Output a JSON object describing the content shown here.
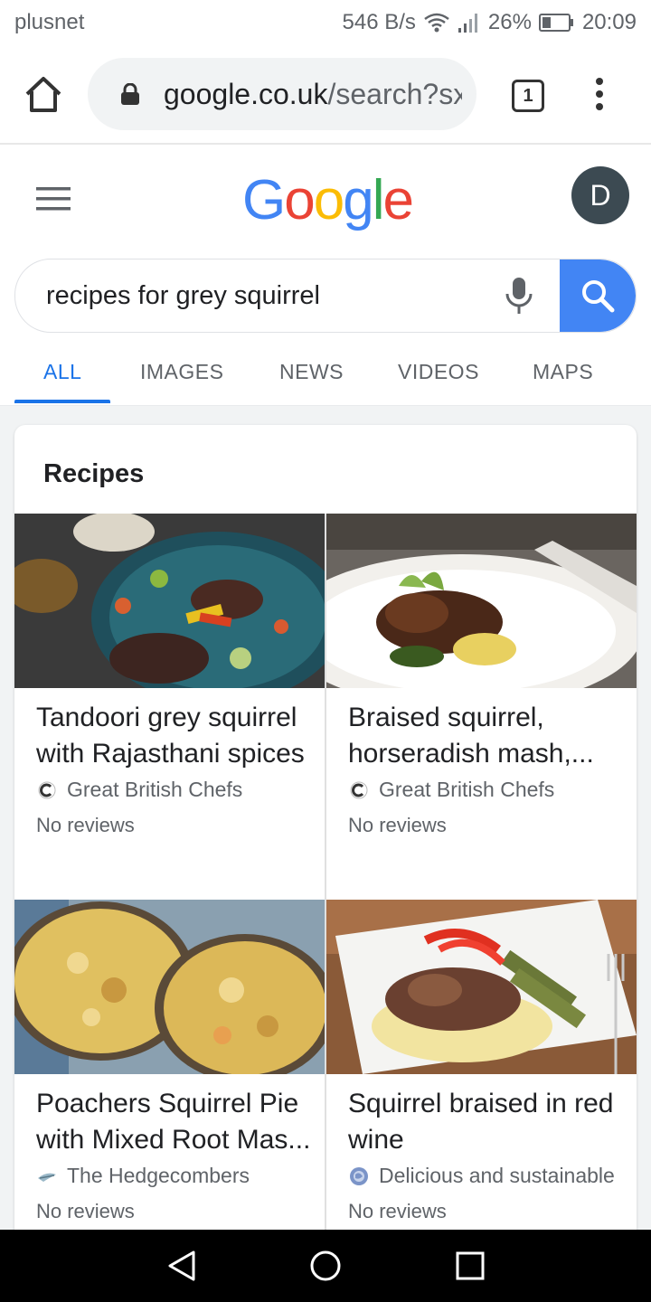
{
  "status_bar": {
    "carrier": "plusnet",
    "speed": "546 B/s",
    "battery": "26%",
    "time": "20:09"
  },
  "browser": {
    "url_host": "google.co.uk",
    "url_path": "/search?sx",
    "tab_count": "1"
  },
  "google": {
    "logo_letters": [
      {
        "ch": "G",
        "color": "#4285F4"
      },
      {
        "ch": "o",
        "color": "#EA4335"
      },
      {
        "ch": "o",
        "color": "#FBBC05"
      },
      {
        "ch": "g",
        "color": "#4285F4"
      },
      {
        "ch": "l",
        "color": "#34A853"
      },
      {
        "ch": "e",
        "color": "#EA4335"
      }
    ],
    "avatar_initial": "D",
    "query": "recipes for grey squirrel",
    "tabs": [
      "ALL",
      "IMAGES",
      "NEWS",
      "VIDEOS",
      "MAPS"
    ],
    "active_tab": "ALL"
  },
  "recipes": {
    "heading": "Recipes",
    "items": [
      {
        "title": "Tandoori grey squirrel with Rajasthani spices",
        "source": "Great British Chefs",
        "reviews": "No reviews"
      },
      {
        "title": "Braised squirrel, horseradish mash,...",
        "source": "Great British Chefs",
        "reviews": "No reviews"
      },
      {
        "title": "Poachers Squirrel Pie with Mixed Root Mas...",
        "source": "The Hedgecombers",
        "reviews": "No reviews"
      },
      {
        "title": "Squirrel braised in red wine",
        "source": "Delicious and sustainable",
        "reviews": "No reviews"
      }
    ]
  },
  "colors": {
    "accent": "#1a73e8",
    "search_button": "#4285f4",
    "avatar_bg": "#3c4a52"
  }
}
